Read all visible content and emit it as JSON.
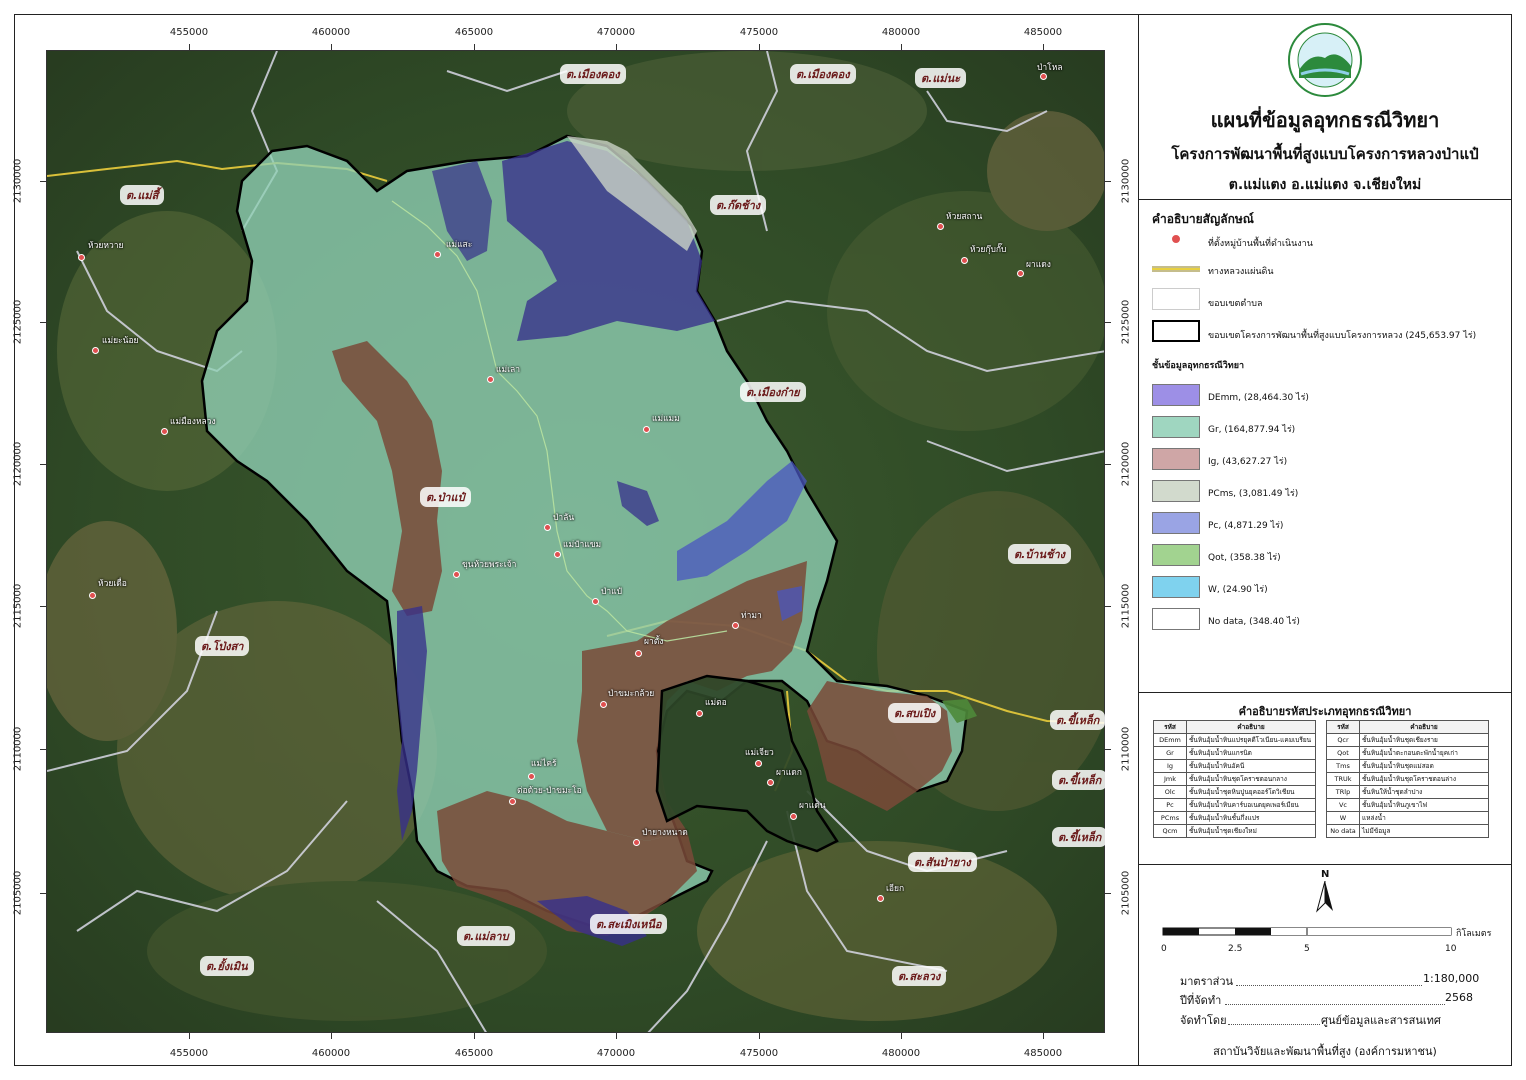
{
  "map": {
    "x_ticks": [
      "455000",
      "460000",
      "465000",
      "470000",
      "475000",
      "480000",
      "485000"
    ],
    "y_ticks": [
      "2130000",
      "2125000",
      "2120000",
      "2115000",
      "2110000",
      "2105000"
    ],
    "subdistrict_labels": [
      "ต.เมืองคอง",
      "ต.เมืองคอง",
      "ต.แม่นะ",
      "ต.แม่สี้",
      "ต.ก๊ดช้าง",
      "ต.เมืองก๋าย",
      "ต.ป่าแป๋",
      "ต.บ้านช้าง",
      "ต.โป่งสา",
      "ต.สบเปิง",
      "ต.ขี้เหล็ก",
      "ต.ขี้เหล็ก",
      "ต.ขี้เหล็ก",
      "ต.สันป่ายาง",
      "ต.แม่ลาบ",
      "ต.สะเมิงเหนือ",
      "ต.ยั้งเมิน",
      "ต.สะลวง"
    ],
    "villages": [
      "ป่าโหล",
      "ห้วยหวาย",
      "แม่แสะ",
      "ห้วยสถาน",
      "ห้วยกุ๊บกั๊บ",
      "ผาแดง",
      "แม่ยะน้อย",
      "แม่เลา",
      "แม่มืองหลวง",
      "แม่แมม",
      "ป่าลัน",
      "แม่ป๋าแขม",
      "ขุนห้วยพระเจ้า",
      "ห้วยเดื่อ",
      "ป่าแป๋",
      "ท่ามา",
      "ผาตั้ง",
      "ป่าขมะกล้วย",
      "แม่ตอ",
      "แม่เจียว",
      "แม่ไคร้",
      "ต่อด้วย-ป่าขมะโอ",
      "ผาแดก",
      "ผาแด่น",
      "ป่ายางหนาด",
      "เอียก"
    ]
  },
  "panel": {
    "title": "แผนที่ข้อมูลอุทกธรณีวิทยา",
    "subtitle": "โครงการพัฒนาพื้นที่สูงแบบโครงการหลวงป่าแป๋",
    "location": "ต.แม่แตง อ.แม่แตง จ.เชียงใหม่",
    "legend_title": "คำอธิบายสัญลักษณ์",
    "legend_items": [
      {
        "label": "ที่ตั้งหมู่บ้านพื้นที่ดำเนินงาน"
      },
      {
        "label": "ทางหลวงแผ่นดิน"
      },
      {
        "label": "ขอบเขตตำบล"
      },
      {
        "label": "ขอบเขตโครงการพัฒนาพื้นที่สูงแบบโครงการหลวง (245,653.97 ไร่)"
      }
    ],
    "hydro_title": "ชั้นข้อมูลอุทกธรณีวิทยา",
    "hydro_items": [
      {
        "label": "DEmm, (28,464.30 ไร่)",
        "color": "#9d8fe6"
      },
      {
        "label": "Gr, (164,877.94 ไร่)",
        "color": "#9fd6c0"
      },
      {
        "label": "Ig, (43,627.27 ไร่)",
        "color": "#cfa6a6"
      },
      {
        "label": "PCms, (3,081.49 ไร่)",
        "color": "#d2dacd"
      },
      {
        "label": "Pc, (4,871.29 ไร่)",
        "color": "#9aa4e4"
      },
      {
        "label": "Qot, (358.38 ไร่)",
        "color": "#a2d390"
      },
      {
        "label": "W, (24.90 ไร่)",
        "color": "#7fd2ee"
      },
      {
        "label": "No data, (348.40 ไร่)",
        "color": "#ffffff"
      }
    ],
    "code_title": "คำอธิบายรหัสประเภทอุทกธรณีวิทยา",
    "code_header": {
      "code": "รหัส",
      "desc": "คำอธิบาย"
    },
    "codes_left": [
      {
        "code": "DEmm",
        "desc": "ชั้นหินอุ้มน้ำหินแปรยุคดีโวเนียน-แคมเบรียน"
      },
      {
        "code": "Gr",
        "desc": "ชั้นหินอุ้มน้ำหินแกรนิต"
      },
      {
        "code": "Ig",
        "desc": "ชั้นหินอุ้มน้ำหินอัคนี"
      },
      {
        "code": "Jmk",
        "desc": "ชั้นหินอุ้มน้ำหินชุดโคราชตอนกลาง"
      },
      {
        "code": "Olc",
        "desc": "ชั้นหินอุ้มน้ำชุดหินปูนยุคออร์โดวิเชียน"
      },
      {
        "code": "Pc",
        "desc": "ชั้นหินอุ้มน้ำหินคาร์บอเนตยุคเพอร์เมียน"
      },
      {
        "code": "PCms",
        "desc": "ชั้นหินอุ้มน้ำหินชั้นกึ่งแปร"
      },
      {
        "code": "Qcm",
        "desc": "ชั้นหินอุ้มน้ำชุดเชียงใหม่"
      }
    ],
    "codes_right": [
      {
        "code": "Qcr",
        "desc": "ชั้นหินอุ้มน้ำหินชุดเชียงราย"
      },
      {
        "code": "Qot",
        "desc": "ชั้นหินอุ้มน้ำตะกอนตะพักน้ำยุคเก่า"
      },
      {
        "code": "Tms",
        "desc": "ชั้นหินอุ้มน้ำหินชุดแม่สอด"
      },
      {
        "code": "TRUk",
        "desc": "ชั้นหินอุ้มน้ำหินชุดโคราชตอนล่าง"
      },
      {
        "code": "TRlp",
        "desc": "ชั้นหินให้น้ำชุดลำปาง"
      },
      {
        "code": "Vc",
        "desc": "ชั้นหินอุ้มน้ำหินภูเขาไฟ"
      },
      {
        "code": "W",
        "desc": "แหล่งน้ำ"
      },
      {
        "code": "No data",
        "desc": "ไม่มีข้อมูล"
      }
    ],
    "north": "N",
    "scale_ticks": [
      "0",
      "2.5",
      "5",
      "10"
    ],
    "scale_unit": "กิโลเมตร",
    "info": [
      {
        "label": "มาตราส่วน",
        "value": "1:180,000"
      },
      {
        "label": "ปีที่จัดทำ",
        "value": "2568"
      },
      {
        "label": "จัดทำโดย",
        "value": "ศูนย์ข้อมูลและสารสนเทศ"
      }
    ],
    "footer": "สถาบันวิจัยและพัฒนาพื้นที่สูง (องค์การมหาชน)"
  }
}
